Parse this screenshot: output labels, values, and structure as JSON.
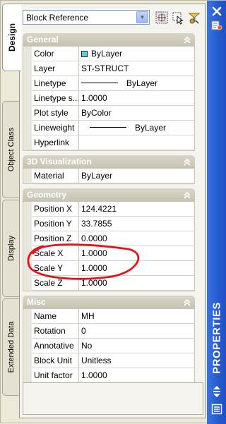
{
  "dropdown": {
    "selected": "Block Reference"
  },
  "tabs": [
    "Design",
    "Object Class",
    "Display",
    "Extended Data"
  ],
  "sections": [
    {
      "title": "General",
      "rows": [
        {
          "name": "Color",
          "value": "ByLayer"
        },
        {
          "name": "Layer",
          "value": "ST-STRUCT"
        },
        {
          "name": "Linetype",
          "value": "ByLayer"
        },
        {
          "name": "Linetype s...",
          "value": "1.0000"
        },
        {
          "name": "Plot style",
          "value": "ByColor"
        },
        {
          "name": "Lineweight",
          "value": "ByLayer"
        },
        {
          "name": "Hyperlink",
          "value": ""
        }
      ]
    },
    {
      "title": "3D Visualization",
      "rows": [
        {
          "name": "Material",
          "value": "ByLayer"
        }
      ]
    },
    {
      "title": "Geometry",
      "rows": [
        {
          "name": "Position X",
          "value": "124.4221"
        },
        {
          "name": "Position Y",
          "value": "33.7855"
        },
        {
          "name": "Position Z",
          "value": "0.0000"
        },
        {
          "name": "Scale X",
          "value": "1.0000"
        },
        {
          "name": "Scale Y",
          "value": "1.0000"
        },
        {
          "name": "Scale Z",
          "value": "1.0000"
        }
      ]
    },
    {
      "title": "Misc",
      "rows": [
        {
          "name": "Name",
          "value": "MH"
        },
        {
          "name": "Rotation",
          "value": "0"
        },
        {
          "name": "Annotative",
          "value": "No"
        },
        {
          "name": "Block Unit",
          "value": "Unitless"
        },
        {
          "name": "Unit factor",
          "value": "1.0000"
        }
      ]
    }
  ],
  "palette_title": "PROPERTIES",
  "colors": {
    "titlebar": "#2559d0",
    "section_header": "#c6c3b2",
    "annotation": "#e0141c",
    "color_swatch": "#5fd0d8"
  },
  "icons": [
    "chevron-down-icon",
    "quick-select-icon",
    "select-objects-icon",
    "pickadd-icon",
    "close-icon",
    "palette-properties-icon",
    "collapse-section-icon",
    "autohide-icon",
    "palette-menu-icon"
  ]
}
